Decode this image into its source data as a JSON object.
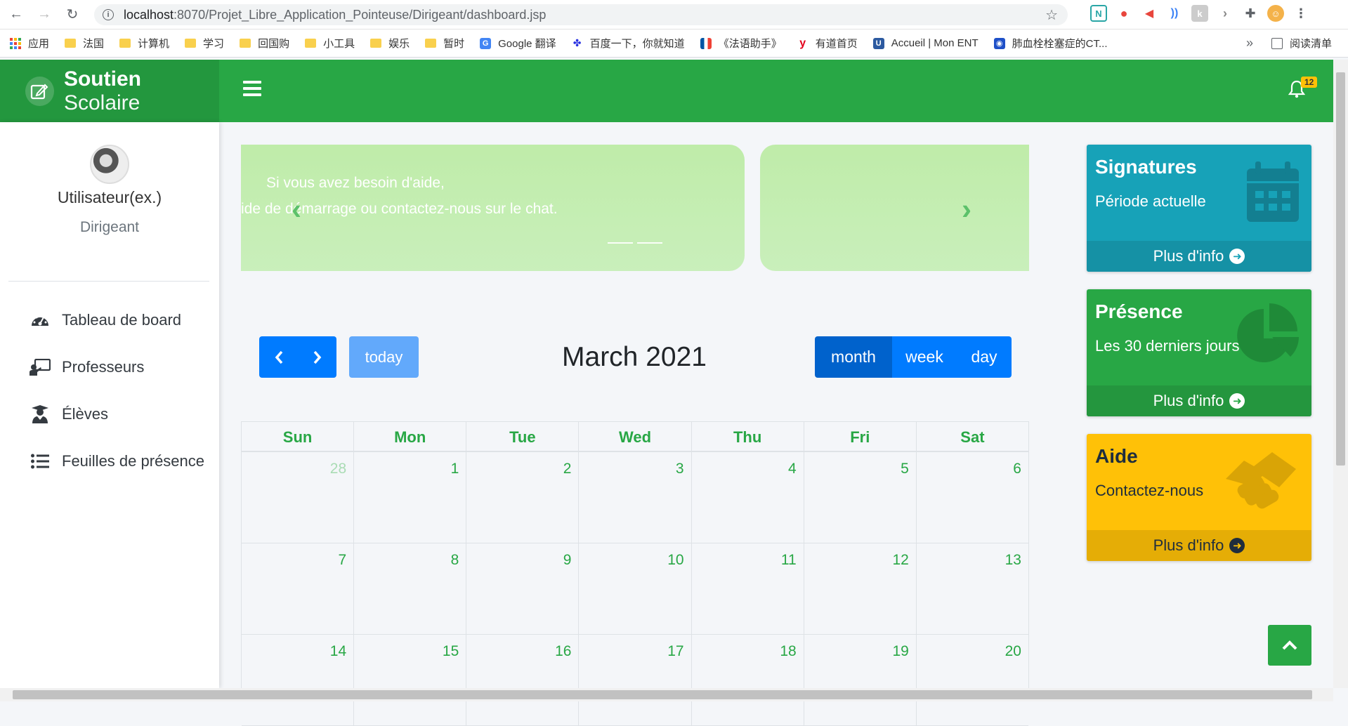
{
  "browser": {
    "url_host": "localhost",
    "url_path": ":8070/Projet_Libre_Application_Pointeuse/Dirigeant/dashboard.jsp",
    "bookmarks": [
      "应用",
      "法国",
      "计算机",
      "学习",
      "回国购",
      "小工具",
      "娱乐",
      "暂时",
      "Google 翻译",
      "百度一下，你就知道",
      "《法语助手》",
      "有道首页",
      "Accueil | Mon ENT",
      "肺血栓栓塞症的CT..."
    ],
    "more": "»",
    "reading_list": "阅读清单"
  },
  "header": {
    "brand_bold": "Soutien",
    "brand_rest": " Scolaire",
    "notification_count": "12"
  },
  "sidebar": {
    "user_name": "Utilisateur(ex.)",
    "user_role": "Dirigeant",
    "items": [
      {
        "label": "Tableau de board",
        "icon": "tachometer-icon"
      },
      {
        "label": "Professeurs",
        "icon": "chalkboard-teacher-icon"
      },
      {
        "label": "Élèves",
        "icon": "user-graduate-icon"
      },
      {
        "label": "Feuilles de présence",
        "icon": "list-icon"
      }
    ]
  },
  "carousel": {
    "line1": "Si vous avez besoin d'aide,",
    "line2": "ide de démarrage ou contactez-nous sur le chat."
  },
  "calendar": {
    "title": "March 2021",
    "today": "today",
    "views": [
      "month",
      "week",
      "day"
    ],
    "active_view": "month",
    "days": [
      "Sun",
      "Mon",
      "Tue",
      "Wed",
      "Thu",
      "Fri",
      "Sat"
    ],
    "weeks": [
      [
        "28",
        "1",
        "2",
        "3",
        "4",
        "5",
        "6"
      ],
      [
        "7",
        "8",
        "9",
        "10",
        "11",
        "12",
        "13"
      ],
      [
        "14",
        "15",
        "16",
        "17",
        "18",
        "19",
        "20"
      ]
    ]
  },
  "boxes": {
    "signatures": {
      "title": "Signatures",
      "subtitle": "Période actuelle",
      "footer": "Plus d'info"
    },
    "presence": {
      "title": "Présence",
      "subtitle": "Les 30 derniers jours",
      "footer": "Plus d'info"
    },
    "aide": {
      "title": "Aide",
      "subtitle": "Contactez-nous",
      "footer": "Plus d'info"
    }
  },
  "colors": {
    "primary_green": "#28a745",
    "info": "#17a2b8",
    "warning": "#ffc107",
    "blue": "#007bff"
  }
}
